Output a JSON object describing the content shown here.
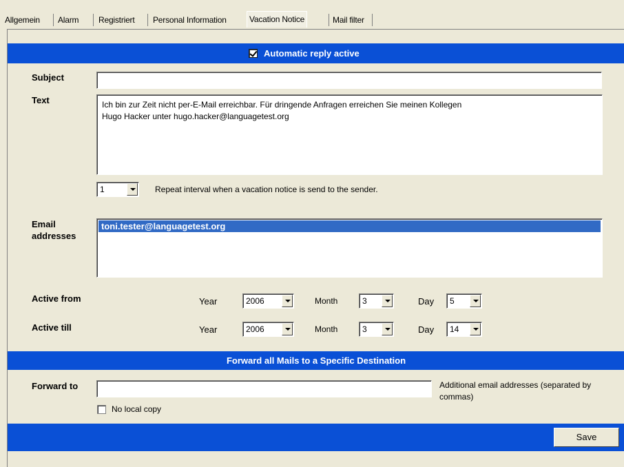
{
  "tabs": [
    {
      "label": "Allgemein"
    },
    {
      "label": "Alarm"
    },
    {
      "label": "Registriert"
    },
    {
      "label": "Personal Information"
    },
    {
      "label": "Vacation Notice",
      "active": true
    },
    {
      "label": "Mail filter"
    }
  ],
  "vacation": {
    "auto_reply_label": "Automatic reply active",
    "auto_reply_checked": true,
    "subject_label": "Subject",
    "subject_value": "",
    "text_label": "Text",
    "text_value": "Ich bin zur Zeit nicht per-E-Mail erreichbar. Für dringende Anfragen erreichen Sie meinen Kollegen\nHugo Hacker unter hugo.hacker@languagetest.org",
    "repeat_interval_value": "1",
    "repeat_interval_text": "Repeat interval when a vacation notice is send to the sender.",
    "email_label": "Email addresses",
    "email_addresses": [
      "toni.tester@languagetest.org"
    ],
    "active_from": {
      "label": "Active from",
      "year_label": "Year",
      "year": "2006",
      "month_label": "Month",
      "month": "3",
      "day_label": "Day",
      "day": "5"
    },
    "active_till": {
      "label": "Active till",
      "year_label": "Year",
      "year": "2006",
      "month_label": "Month",
      "month": "3",
      "day_label": "Day",
      "day": "14"
    }
  },
  "forward": {
    "section_title": "Forward all Mails to a Specific Destination",
    "forward_label": "Forward to",
    "forward_value": "",
    "additional_text": "Additional email addresses (separated by commas)",
    "no_local_copy_label": "No local copy",
    "no_local_copy_checked": false
  },
  "save_label": "Save",
  "colors": {
    "bar": "#0a50d6",
    "selection": "#316ac5",
    "background": "#ece9d8"
  }
}
